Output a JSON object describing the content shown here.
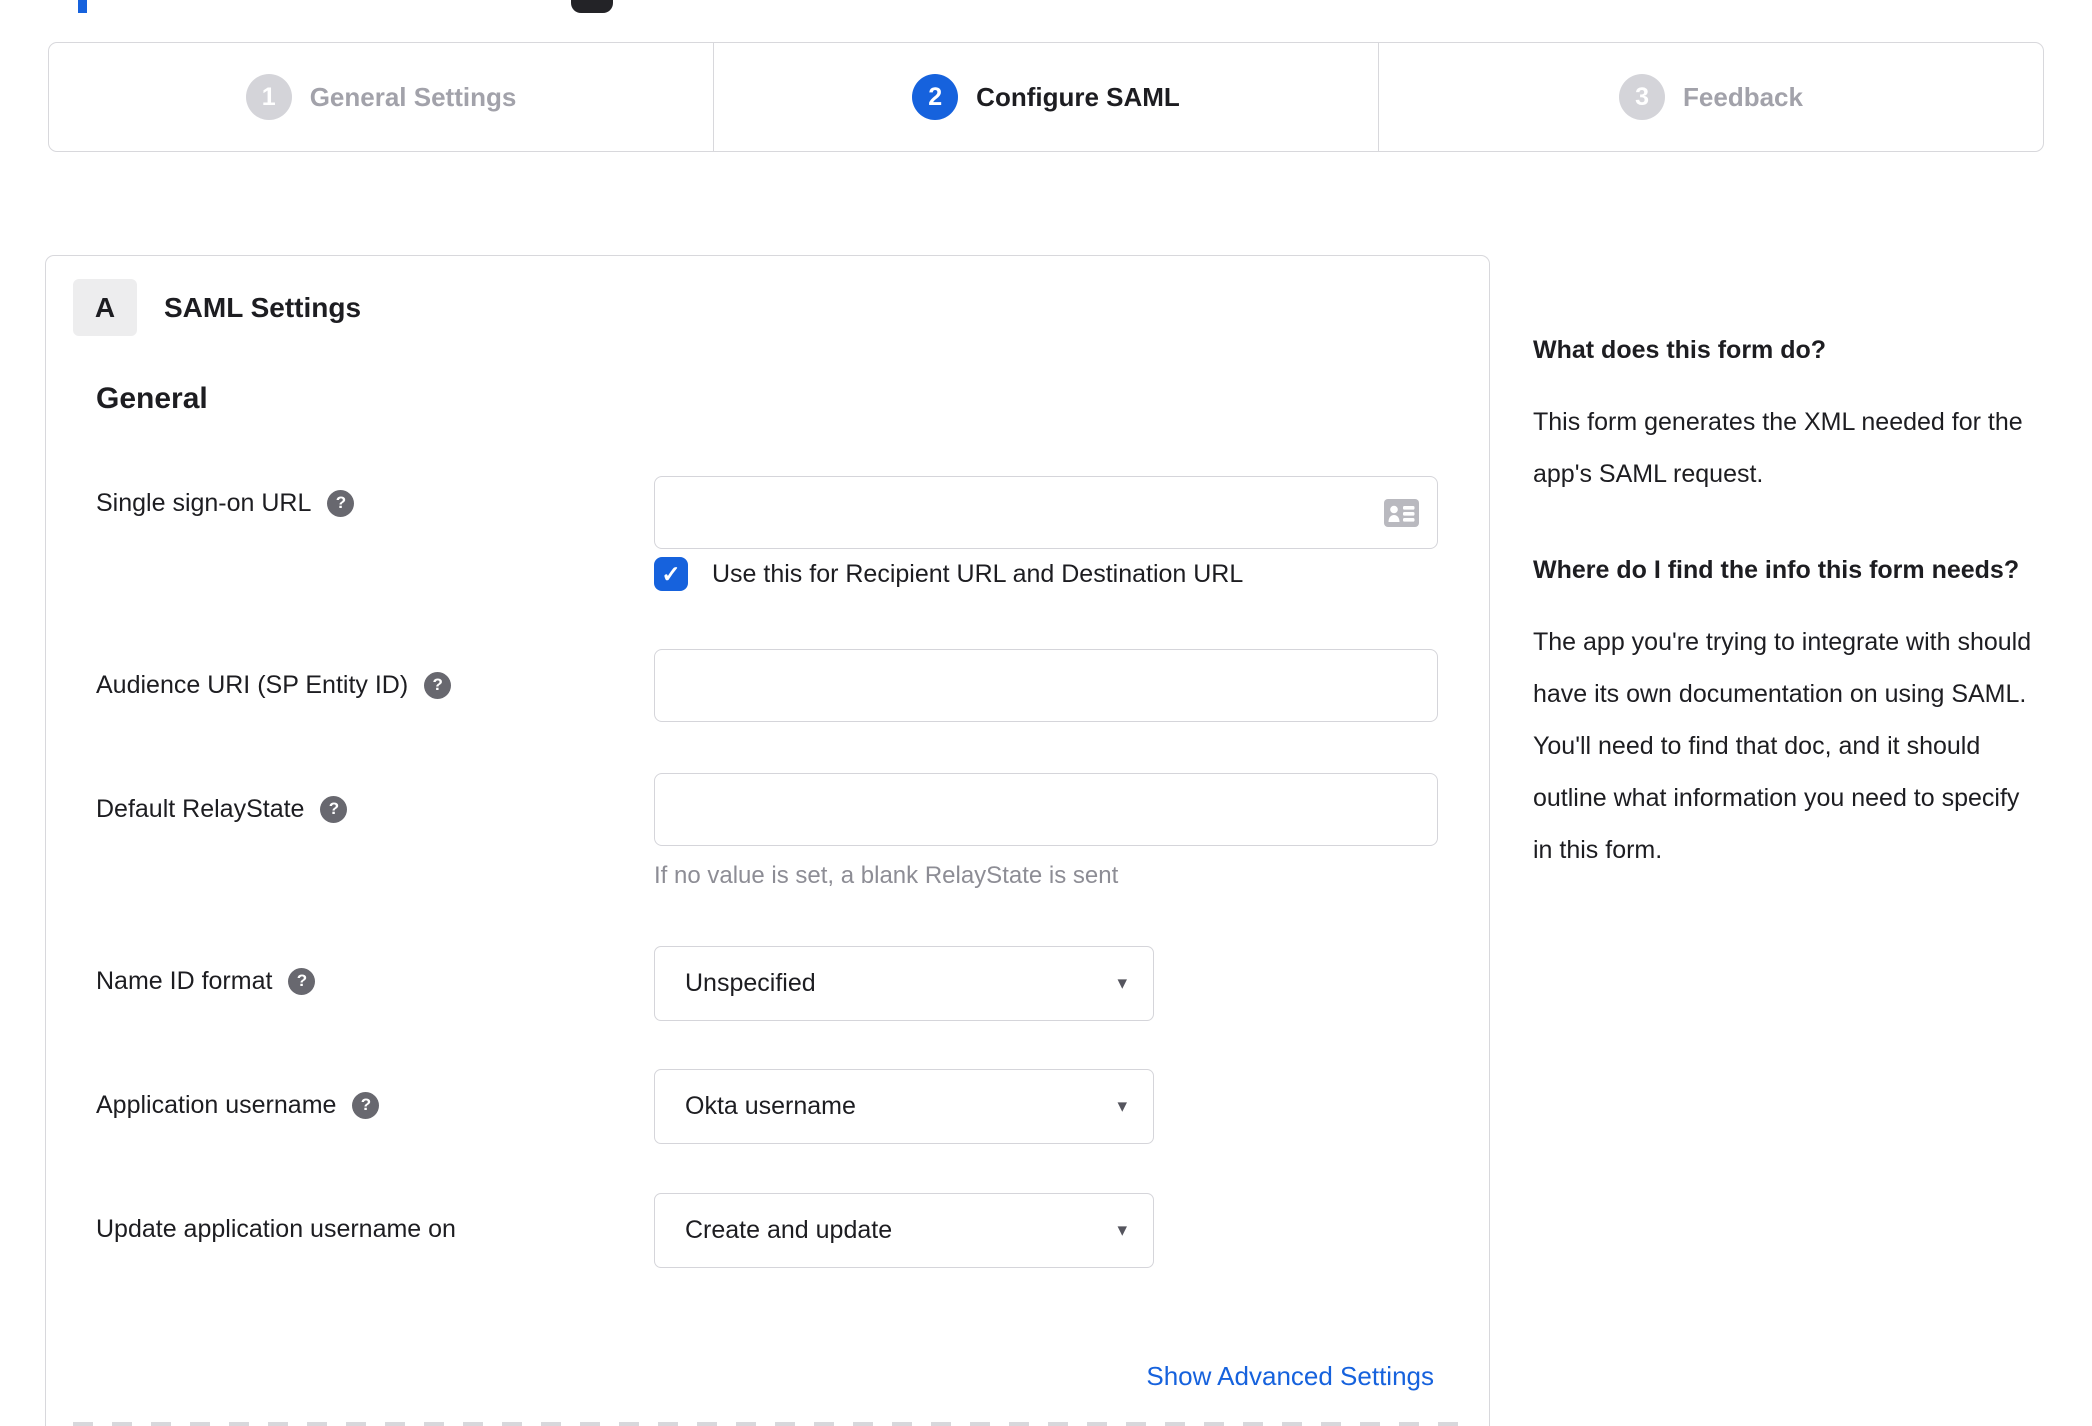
{
  "colors": {
    "accent_blue": "#1662dd",
    "border_gray": "#d8d8dc",
    "muted_text": "#8d8d95",
    "dark_text": "#1d1d21"
  },
  "icons": {
    "help_glyph": "?",
    "check_glyph": "✓",
    "dropdown_glyph": "▾"
  },
  "stepper": {
    "steps": [
      {
        "number": "1",
        "label": "General Settings",
        "state": "inactive"
      },
      {
        "number": "2",
        "label": "Configure SAML",
        "state": "active"
      },
      {
        "number": "3",
        "label": "Feedback",
        "state": "inactive"
      }
    ]
  },
  "panel": {
    "section_badge": "A",
    "section_title": "SAML Settings",
    "group_title": "General",
    "fields": {
      "sso_url": {
        "label": "Single sign-on URL",
        "value": "",
        "checkbox_label": "Use this for Recipient URL and Destination URL",
        "checkbox_checked": true
      },
      "audience_uri": {
        "label": "Audience URI (SP Entity ID)",
        "value": ""
      },
      "default_relaystate": {
        "label": "Default RelayState",
        "value": "",
        "help_text": "If no value is set, a blank RelayState is sent"
      },
      "name_id_format": {
        "label": "Name ID format",
        "value": "Unspecified"
      },
      "application_username": {
        "label": "Application username",
        "value": "Okta username"
      },
      "update_app_username": {
        "label": "Update application username on",
        "value": "Create and update"
      }
    },
    "advanced_link": "Show Advanced Settings"
  },
  "sidebar": {
    "sections": [
      {
        "heading": "What does this form do?",
        "body": "This form generates the XML needed for the app's SAML request."
      },
      {
        "heading": "Where do I find the info this form needs?",
        "body": "The app you're trying to integrate with should have its own documentation on using SAML. You'll need to find that doc, and it should outline what information you need to specify in this form."
      }
    ]
  }
}
